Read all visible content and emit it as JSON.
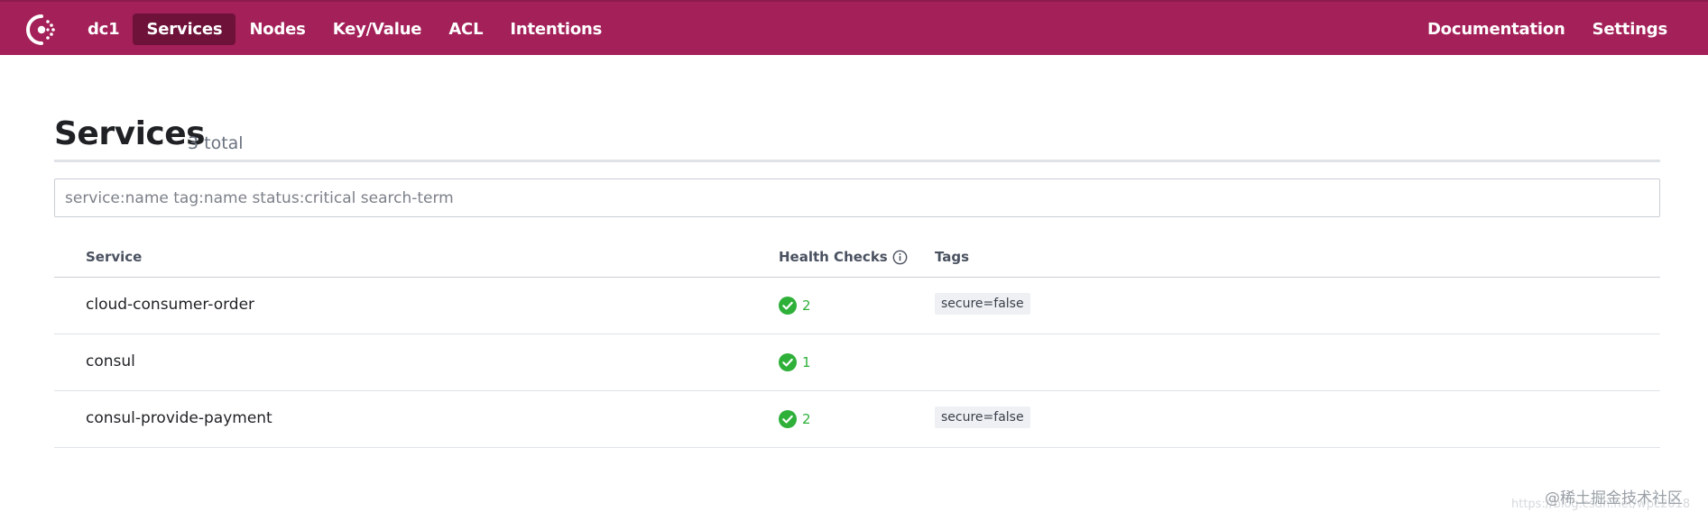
{
  "nav": {
    "datacenter": "dc1",
    "items": [
      "Services",
      "Nodes",
      "Key/Value",
      "ACL",
      "Intentions"
    ],
    "active": "Services",
    "right": [
      "Documentation",
      "Settings"
    ]
  },
  "page": {
    "title": "Services",
    "count": "3 total"
  },
  "search": {
    "placeholder": "service:name tag:name status:critical search-term",
    "value": ""
  },
  "table": {
    "headers": {
      "service": "Service",
      "health": "Health Checks",
      "tags": "Tags"
    },
    "rows": [
      {
        "name": "cloud-consumer-order",
        "health_passing": "2",
        "tag": "secure=false"
      },
      {
        "name": "consul",
        "health_passing": "1",
        "tag": ""
      },
      {
        "name": "consul-provide-payment",
        "health_passing": "2",
        "tag": "secure=false"
      }
    ]
  },
  "colors": {
    "brand": "#a32058",
    "active_nav": "#6e1239",
    "passing": "#2eb039"
  },
  "icons": {
    "logo": "consul-logo-icon",
    "health_info": "info-icon",
    "passing": "check-circle-icon"
  },
  "watermark": {
    "line1": "@稀土掘金技术社区",
    "line2": "https://blog.csdn.net/wpc2018"
  }
}
